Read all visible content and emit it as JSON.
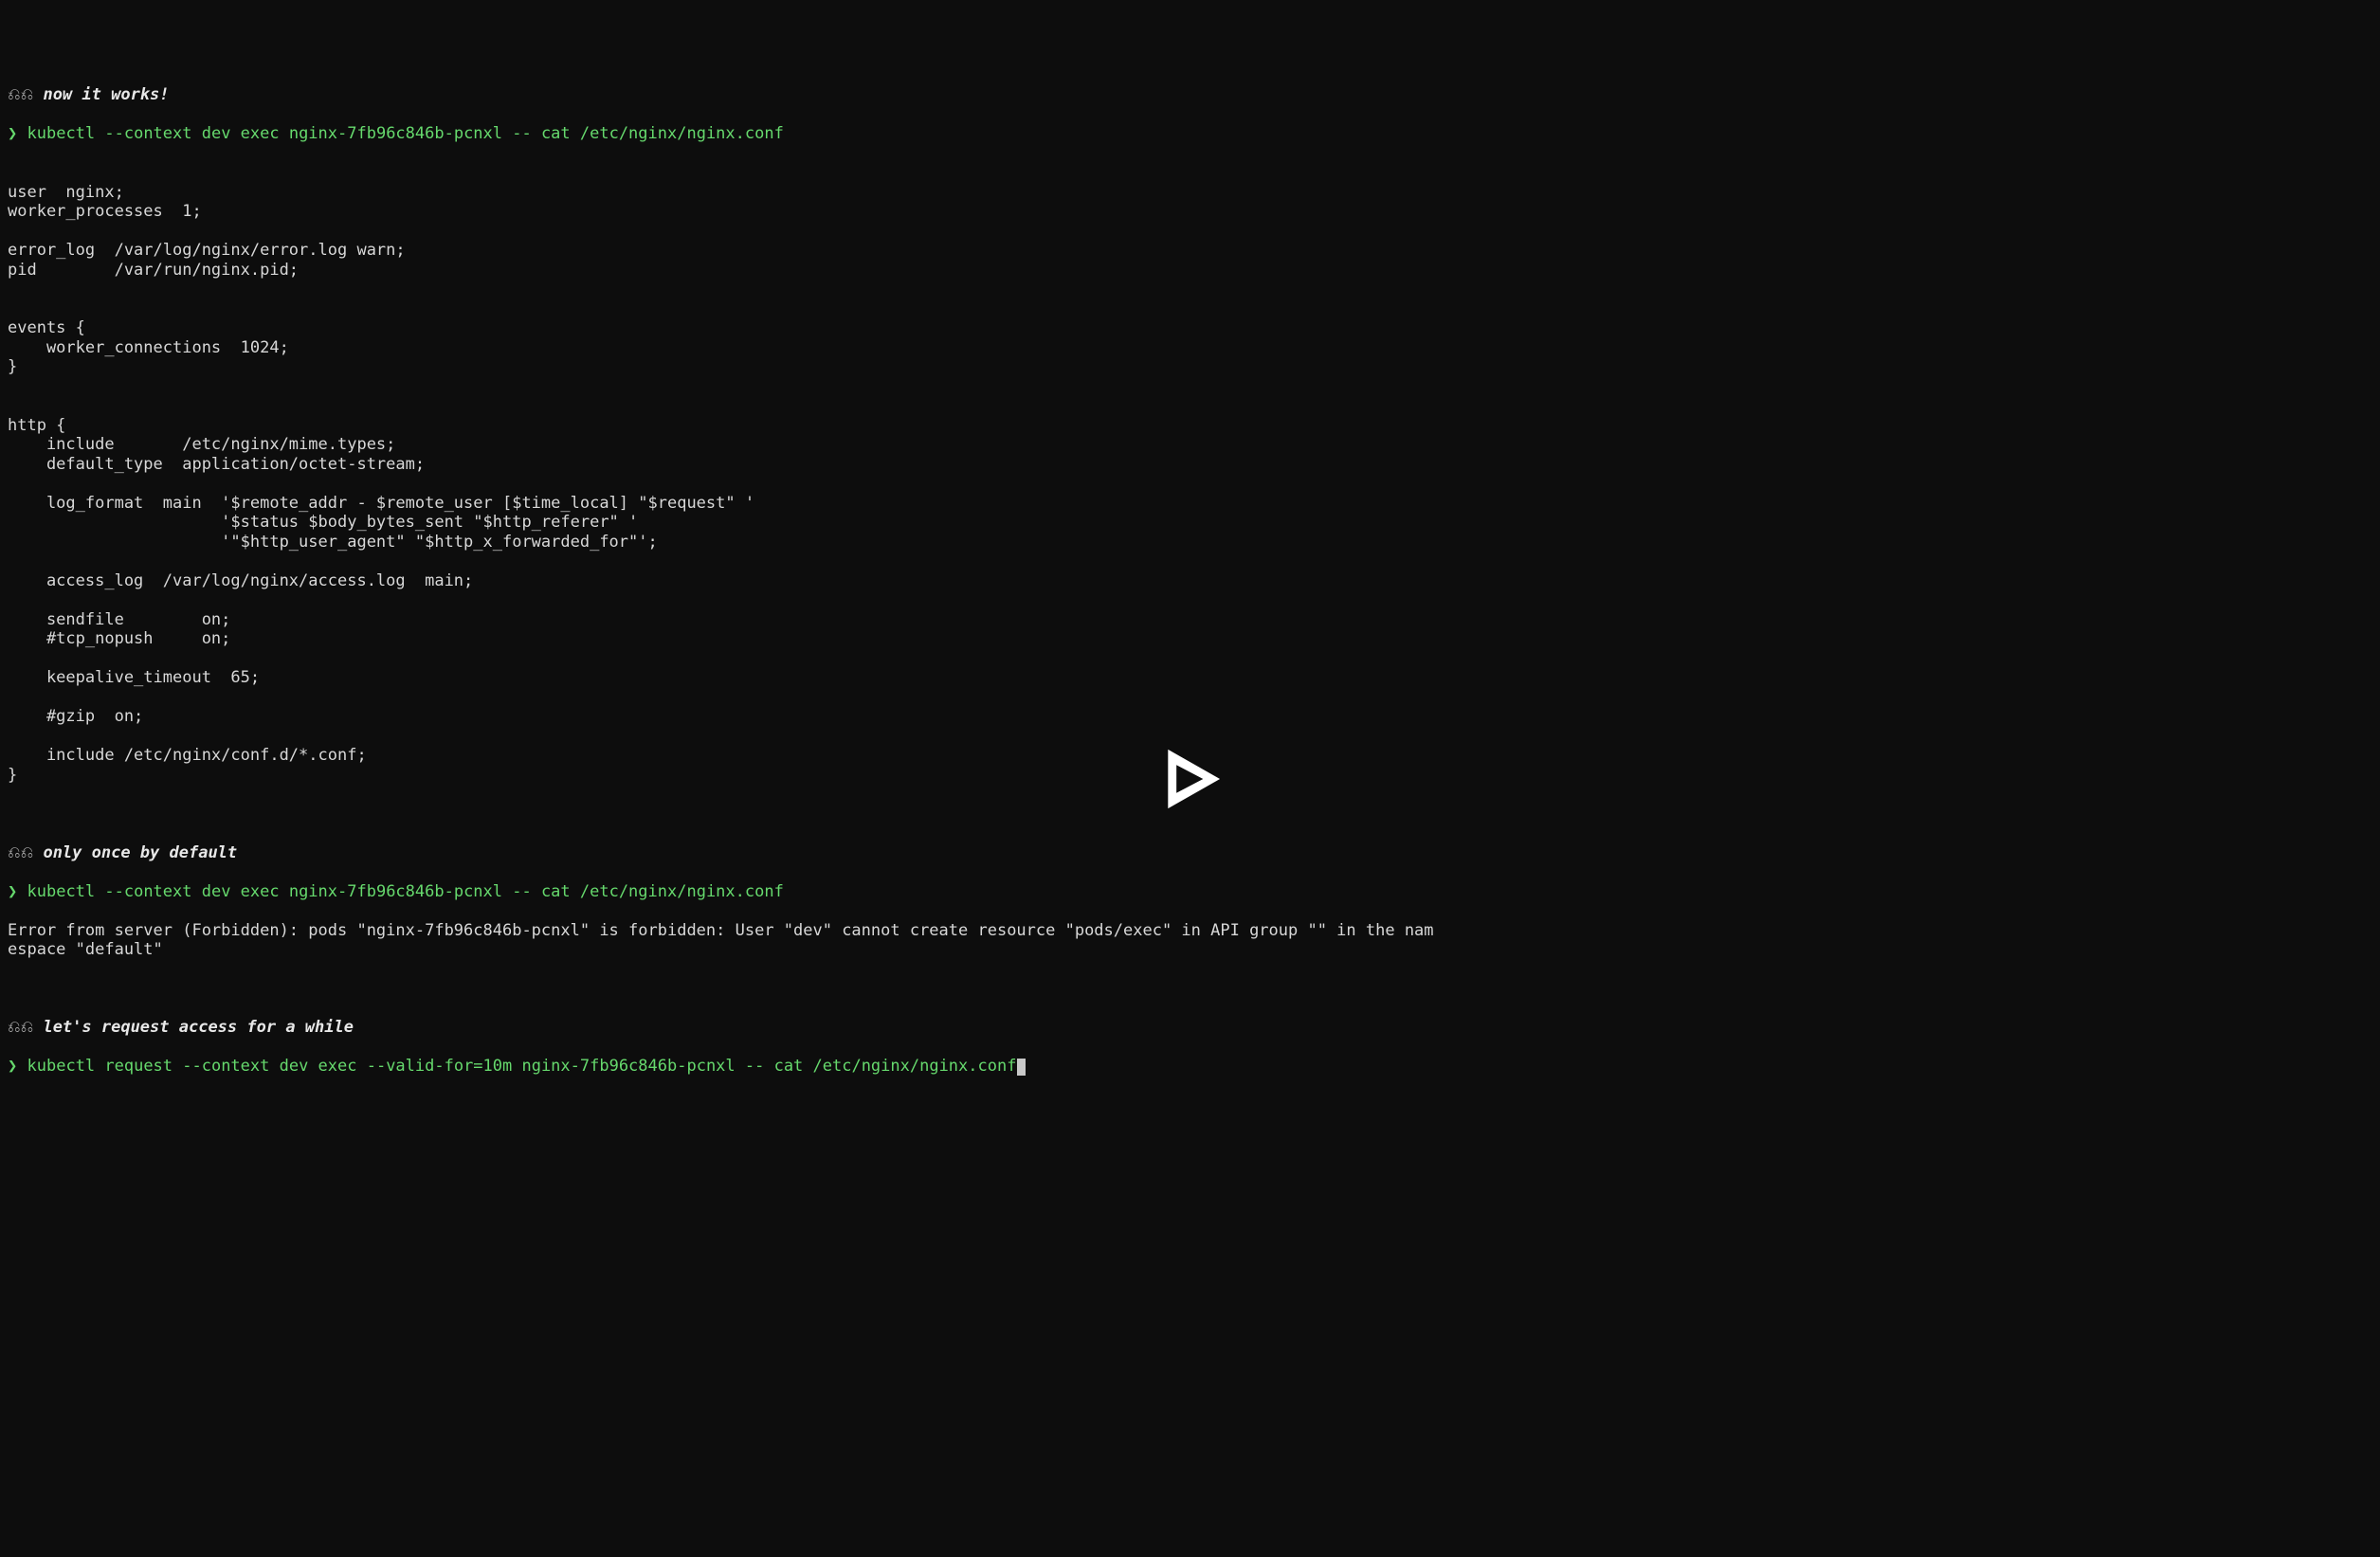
{
  "section1": {
    "glyph": "⎌⎌",
    "comment": "now it works!",
    "prompt": "❯",
    "cmd": "kubectl --context dev exec nginx-7fb96c846b-pcnxl -- cat /etc/nginx/nginx.conf",
    "output": "\nuser  nginx;\nworker_processes  1;\n\nerror_log  /var/log/nginx/error.log warn;\npid        /var/run/nginx.pid;\n\n\nevents {\n    worker_connections  1024;\n}\n\n\nhttp {\n    include       /etc/nginx/mime.types;\n    default_type  application/octet-stream;\n\n    log_format  main  '$remote_addr - $remote_user [$time_local] \"$request\" '\n                      '$status $body_bytes_sent \"$http_referer\" '\n                      '\"$http_user_agent\" \"$http_x_forwarded_for\"';\n\n    access_log  /var/log/nginx/access.log  main;\n\n    sendfile        on;\n    #tcp_nopush     on;\n\n    keepalive_timeout  65;\n\n    #gzip  on;\n\n    include /etc/nginx/conf.d/*.conf;\n}"
  },
  "section2": {
    "glyph": "⎌⎌",
    "comment": "only once by default",
    "prompt": "❯",
    "cmd": "kubectl --context dev exec nginx-7fb96c846b-pcnxl -- cat /etc/nginx/nginx.conf",
    "error": "Error from server (Forbidden): pods \"nginx-7fb96c846b-pcnxl\" is forbidden: User \"dev\" cannot create resource \"pods/exec\" in API group \"\" in the nam\nespace \"default\""
  },
  "section3": {
    "glyph": "⎌⎌",
    "comment": "let's request access for a while",
    "prompt": "❯",
    "cmd": "kubectl request --context dev exec --valid-for=10m nginx-7fb96c846b-pcnxl -- cat /etc/nginx/nginx.conf"
  },
  "overlay": {
    "icon": "play-icon"
  }
}
